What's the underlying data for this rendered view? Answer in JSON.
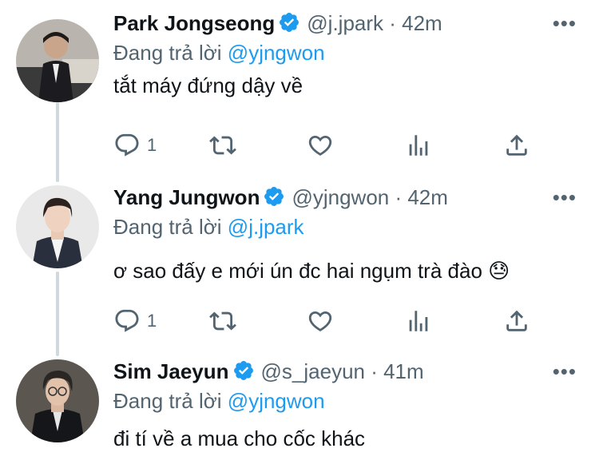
{
  "tweets": [
    {
      "name": "Park Jongseong",
      "meta": "@j.jpark · 42m",
      "reply_prefix": "Đang trả lời",
      "reply_to": "@yjngwon",
      "text": "tắt máy đứng dậy về",
      "reply_count": "1",
      "more": "•••"
    },
    {
      "name": "Yang Jungwon",
      "meta": "@yjngwon · 42m",
      "reply_prefix": "Đang trả lời",
      "reply_to": "@j.jpark",
      "text": "ơ sao đấy e mới ún đc hai ngụm trà đào",
      "emoji": "😓",
      "reply_count": "1",
      "more": "•••"
    },
    {
      "name": "Sim Jaeyun",
      "meta": "@s_jaeyun · 41m",
      "reply_prefix": "Đang trả lời",
      "reply_to": "@yjngwon",
      "text": "đi tí về a mua cho cốc khác",
      "more": "•••"
    }
  ],
  "colors": {
    "verified": "#1d9bf0",
    "mention": "#1d9bf0",
    "muted": "#536471",
    "thread_line": "#cfd9de"
  },
  "icons": [
    "reply-icon",
    "retweet-icon",
    "like-icon",
    "views-icon",
    "share-icon",
    "more-icon",
    "verified-badge-icon"
  ]
}
